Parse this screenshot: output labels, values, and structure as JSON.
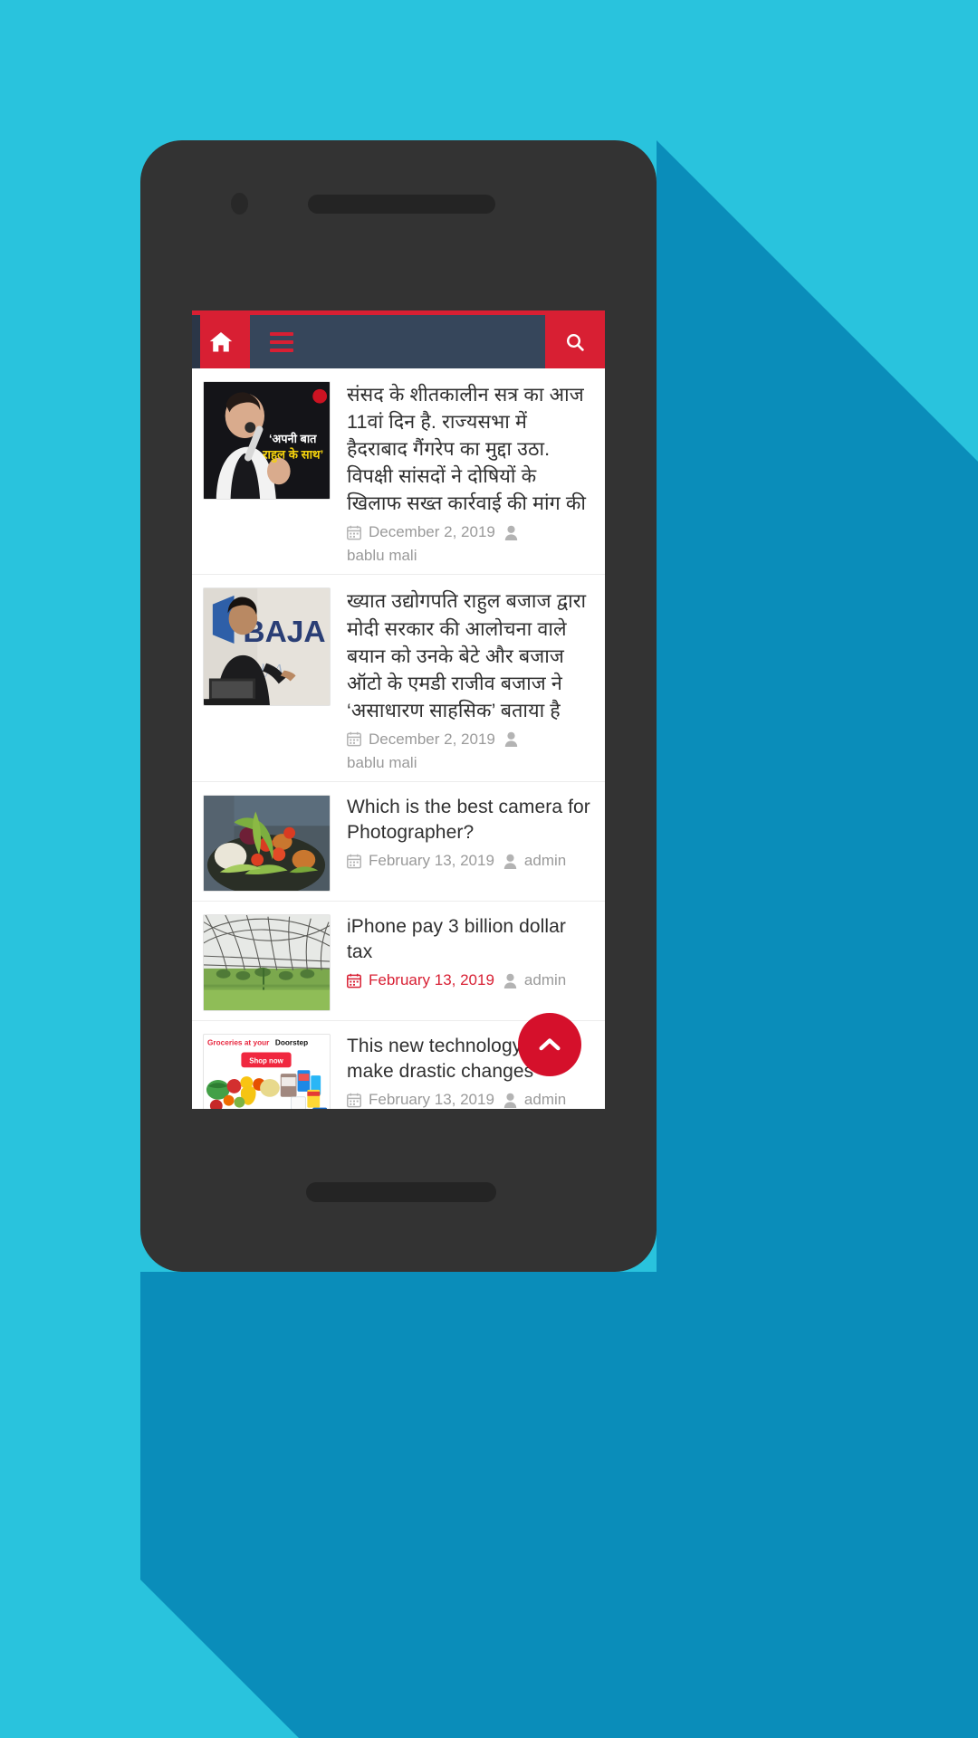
{
  "theme": {
    "background_cyan": "#29c3dd",
    "background_shadow": "#0a8dba",
    "phone_body": "#333333",
    "accent_red": "#d81f33",
    "header_navy": "#36465b",
    "fab_red": "#d5102b",
    "meta_gray": "#9a9a9a"
  },
  "header": {
    "home_icon": "home-icon",
    "menu_icon": "hamburger-menu-icon",
    "search_icon": "search-icon"
  },
  "posts": [
    {
      "id": "post-1",
      "title": "संसद के शीतकालीन सत्र का आज 11वां दिन है. राज्यसभा में हैदराबाद गैंगरेप का मुद्दा उठा. विपक्षी सांसदों ने दोषियों के खिलाफ सख्त कार्रवाई की मांग की",
      "date": "December 2, 2019",
      "author": "bablu mali",
      "date_highlighted": false,
      "author_below": true,
      "thumb_name": "rahul-gandhi-thumbnail",
      "thumb_caption": "‘अपनी बात राहुल के साथ’"
    },
    {
      "id": "post-2",
      "title": "ख्यात उद्योगपति राहुल बजाज द्वारा मोदी सरकार की आलोचना वाले बयान को उनके बेटे और बजाज ऑटो के एमडी राजीव बजाज ने ‘असाधारण साहसिक’ बताया है",
      "date": "December 2, 2019",
      "author": "bablu mali",
      "date_highlighted": false,
      "author_below": true,
      "thumb_name": "rajiv-bajaj-thumbnail",
      "thumb_caption": "BAJA"
    },
    {
      "id": "post-3",
      "title": "Which is the best camera for Photographer?",
      "date": "February 13, 2019",
      "author": "admin",
      "date_highlighted": false,
      "author_below": false,
      "thumb_name": "vegetables-thumbnail",
      "thumb_caption": ""
    },
    {
      "id": "post-4",
      "title": "iPhone pay 3 billion dollar tax",
      "date": "February 13, 2019",
      "author": "admin",
      "date_highlighted": true,
      "author_below": false,
      "thumb_name": "greenhouse-thumbnail",
      "thumb_caption": ""
    },
    {
      "id": "post-5",
      "title": "This new technology will make drastic changes",
      "date": "February 13, 2019",
      "author": "admin",
      "date_highlighted": false,
      "author_below": false,
      "thumb_name": "groceries-ad-thumbnail",
      "thumb_caption": "Groceries at your Doorstep",
      "thumb_button": "Shop now"
    }
  ],
  "scroll_top": {
    "icon": "chevron-up-icon"
  }
}
